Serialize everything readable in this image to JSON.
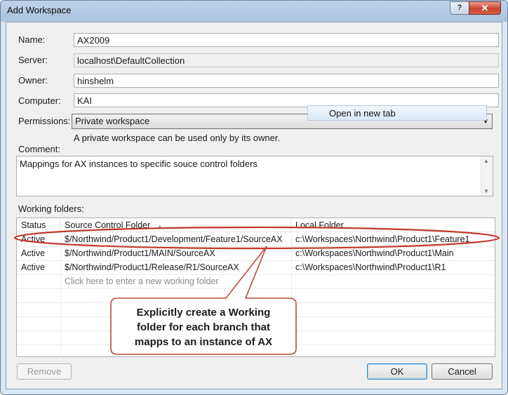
{
  "window": {
    "title": "Add Workspace",
    "help_label": "?",
    "close_label": "✕"
  },
  "form": {
    "name_label": "Name:",
    "name_value": "AX2009",
    "server_label": "Server:",
    "server_value": "localhost\\DefaultCollection",
    "owner_label": "Owner:",
    "owner_value": "hinshelm",
    "computer_label": "Computer:",
    "computer_value": "KAI",
    "permissions_label": "Permissions:",
    "permissions_value": "Private workspace",
    "permissions_help": "A private workspace can be used only by its owner.",
    "comment_label": "Comment:",
    "comment_value": "Mappings for AX instances to specific souce control folders"
  },
  "context_menu": {
    "item": "Open in new tab"
  },
  "working_folders": {
    "label": "Working folders:",
    "columns": {
      "status": "Status",
      "source": "Source Control Folder",
      "local": "Local Folder"
    },
    "rows": [
      {
        "status": "Active",
        "source": "$/Northwind/Product1/Development/Feature1/SourceAX",
        "local": "c:\\Workspaces\\Northwind\\Product1\\Feature1"
      },
      {
        "status": "Active",
        "source": "$/Northwind/Product1/MAIN/SourceAX",
        "local": "c:\\Workspaces\\Northwind\\Product1\\Main"
      },
      {
        "status": "Active",
        "source": "$/Northwind/Product1/Release/R1/SourceAX",
        "local": "c:\\Workspaces\\Northwind\\Product1\\R1"
      }
    ],
    "new_row_placeholder": "Click here to enter a new working folder"
  },
  "callout": {
    "line1": "Explicitly create a Working",
    "line2": "folder for each branch that",
    "line3": "mapps to an instance of AX"
  },
  "buttons": {
    "remove": "Remove",
    "ok": "OK",
    "cancel": "Cancel"
  },
  "colors": {
    "highlight_ring": "#c0392b",
    "callout_border": "#b94a3c"
  }
}
